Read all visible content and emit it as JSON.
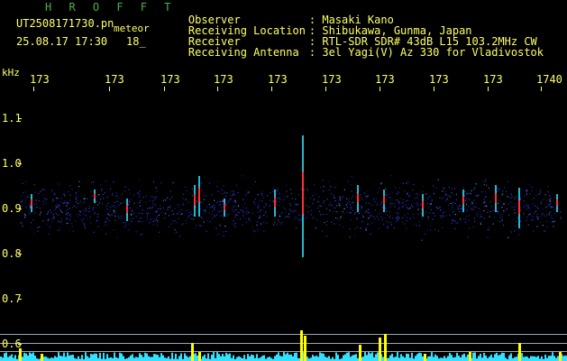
{
  "header": {
    "title": "H R O F F T",
    "filename": "UT2508171730.pn",
    "meteor_label": "meteor",
    "datetime": "25.08.17 17:30",
    "count": "18_"
  },
  "info": [
    {
      "label": "Observer",
      "value": ": Masaki Kano"
    },
    {
      "label": "Receiving Location",
      "value": ": Shibukawa, Gunma, Japan"
    },
    {
      "label": "Receiver",
      "value": ": RTL-SDR SDR# 43dB L15 103.2MHz CW"
    },
    {
      "label": "Receiving Antenna",
      "value": ": 3el Yagi(V) Az 330 for Vladivostok"
    }
  ],
  "axis": {
    "unit": "kHz",
    "x_ticks": [
      "173",
      "173",
      "173",
      "173",
      "173",
      "173",
      "173",
      "173",
      "173",
      "1740"
    ],
    "y_ticks": [
      "1.1",
      "1.0",
      "0.9",
      "0.8",
      "0.7",
      "0.6"
    ]
  },
  "colors": {
    "text": "#ffff66",
    "title": "#4caf4c",
    "noise": "#2a3cff",
    "signal_red": "#ff3030",
    "signal_cyan": "#33e0ff",
    "bar_yellow": "#ffff00"
  }
}
